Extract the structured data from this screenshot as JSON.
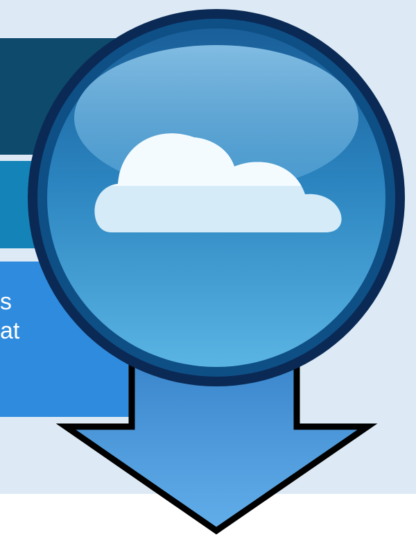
{
  "background": {
    "panel": "#ddeaf6",
    "page": "#ffffff"
  },
  "bars": {
    "dark": "#0e4a6b",
    "mid": "#1483b7",
    "light": "#2f8bde"
  },
  "text_fragments": [
    "s",
    "at"
  ],
  "icon": {
    "name": "cloud-download-icon",
    "ring": "#0a2e5a",
    "globe_top": "#3f96cf",
    "globe_bottom": "#1d6fa8",
    "cloud": "#e9f5fc",
    "arrow": "#4f9fe3"
  }
}
